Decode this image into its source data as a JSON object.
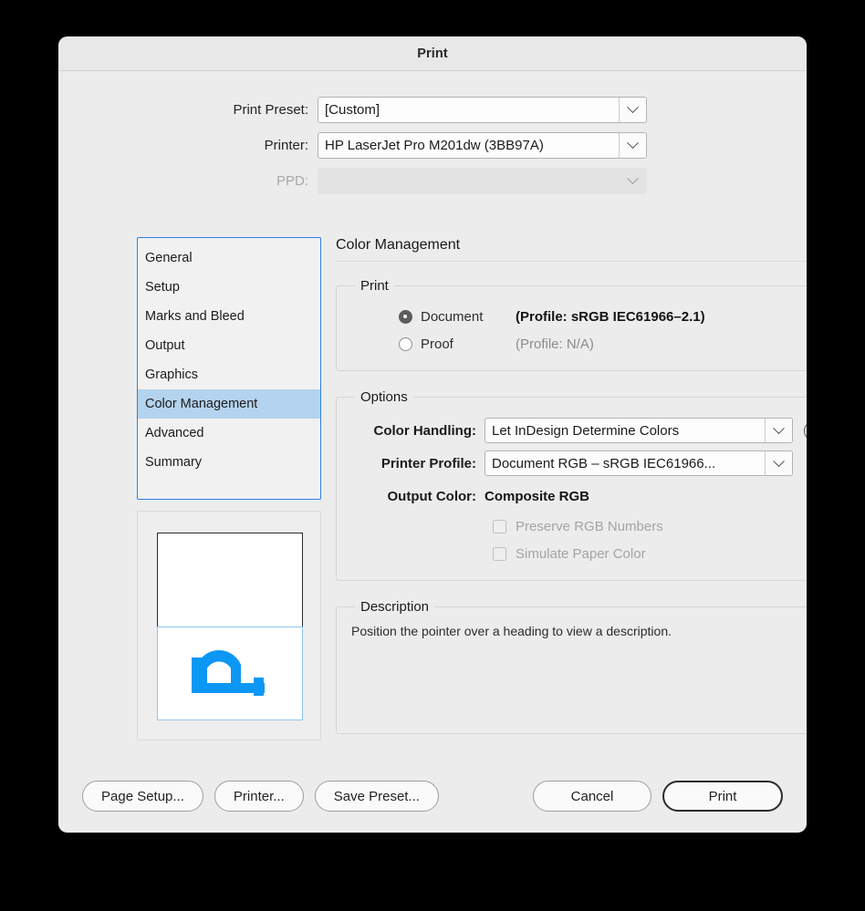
{
  "window": {
    "title": "Print"
  },
  "top_form": {
    "rows": [
      {
        "label": "Print Preset:",
        "value": "[Custom]",
        "disabled": false
      },
      {
        "label": "Printer:",
        "value": "HP LaserJet Pro M201dw (3BB97A)",
        "disabled": false
      },
      {
        "label": "PPD:",
        "value": "",
        "disabled": true
      }
    ]
  },
  "sidebar": {
    "items": [
      {
        "label": "General"
      },
      {
        "label": "Setup"
      },
      {
        "label": "Marks and Bleed"
      },
      {
        "label": "Output"
      },
      {
        "label": "Graphics"
      },
      {
        "label": "Color Management"
      },
      {
        "label": "Advanced"
      },
      {
        "label": "Summary"
      }
    ],
    "selected_index": 5,
    "selection_color": "#b4d3ee",
    "focus_border_color": "#3080e2"
  },
  "preview": {
    "glyph": "page-orientation-P-glyph",
    "glyph_color": "#0d97f5",
    "page_border_color": "#2b2b2b",
    "selected_page_border_color": "#8fc5f4"
  },
  "panel": {
    "title": "Color Management",
    "print_group": {
      "legend": "Print",
      "options": [
        {
          "label": "Document",
          "profile": "(Profile: sRGB IEC61966–2.1)",
          "selected": true,
          "muted": false
        },
        {
          "label": "Proof",
          "profile": "(Profile: N/A)",
          "selected": false,
          "muted": true
        }
      ]
    },
    "options_group": {
      "legend": "Options",
      "color_handling": {
        "label": "Color Handling:",
        "value": "Let InDesign Determine Colors"
      },
      "printer_profile": {
        "label": "Printer Profile:",
        "value": "Document RGB – sRGB IEC61966..."
      },
      "output_color": {
        "label": "Output Color:",
        "value": "Composite RGB"
      },
      "info_icon": "info-icon",
      "checkboxes": [
        {
          "label": "Preserve RGB Numbers",
          "checked": false,
          "disabled": true
        },
        {
          "label": "Simulate Paper Color",
          "checked": false,
          "disabled": true
        }
      ]
    },
    "description_group": {
      "legend": "Description",
      "text": "Position the pointer over a heading to view a description."
    }
  },
  "footer": {
    "page_setup": "Page Setup...",
    "printer": "Printer...",
    "save_preset": "Save Preset...",
    "cancel": "Cancel",
    "print": "Print"
  }
}
